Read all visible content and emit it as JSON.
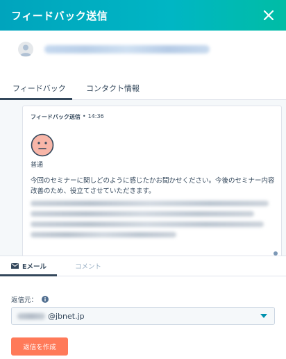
{
  "header": {
    "title": "フィードバック送信",
    "close_icon": "close-icon"
  },
  "contact": {
    "avatar_icon": "avatar-icon"
  },
  "tabs": [
    {
      "label": "フィードバック",
      "active": true
    },
    {
      "label": "コンタクト情報",
      "active": false
    }
  ],
  "feedback_card": {
    "title": "フィードバック送信",
    "separator": "•",
    "time": "14:36",
    "rating_icon": "neutral-face-icon",
    "rating_label": "普通",
    "question": "今回のセミナーに関しどのように感じたかお聞かせください。今後のセミナー内容改善のため、役立てさせていただきます。"
  },
  "compose": {
    "tabs": [
      {
        "label": "Eメール",
        "icon": "envelope-icon",
        "active": true
      },
      {
        "label": "コメント",
        "active": false
      }
    ],
    "from_label": "返信元：",
    "from_info_icon": "info-icon",
    "from_domain": "@jbnet.jp",
    "reply_button": "返信を作成"
  },
  "colors": {
    "header_start": "#00a4bd",
    "header_end": "#00bda5",
    "primary_button": "#ff7a59",
    "text": "#33475b",
    "muted": "#99afc4",
    "feed_bg": "#f5f8fa"
  }
}
